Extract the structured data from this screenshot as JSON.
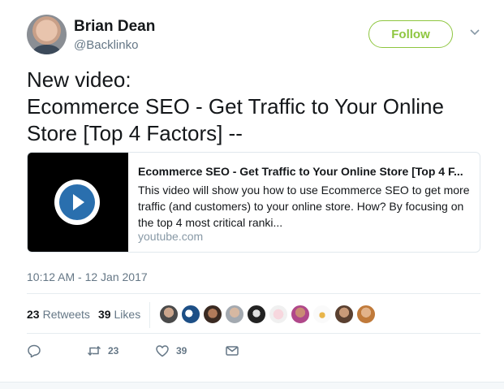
{
  "author": {
    "name": "Brian Dean",
    "handle": "@Backlinko"
  },
  "follow_label": "Follow",
  "tweet_lines": [
    "New video:",
    "Ecommerce SEO - Get Traffic to Your Online",
    "Store [Top 4 Factors] --"
  ],
  "card": {
    "title": "Ecommerce SEO - Get Traffic to Your Online Store [Top 4 F...",
    "description_lines": [
      "This video will show you how to use Ecommerce SEO to get more",
      "traffic (and customers) to your online store. How? By focusing on",
      "the top 4 most critical ranki..."
    ],
    "domain": "youtube.com"
  },
  "timestamp": "10:12 AM - 12 Jan 2017",
  "stats": {
    "retweets_count": "23",
    "retweets_label": "Retweets",
    "likes_count": "39",
    "likes_label": "Likes"
  },
  "actions": {
    "reply_count": "",
    "retweet_count": "23",
    "like_count": "39"
  },
  "colors": {
    "follow_accent": "#8ec63f",
    "play_button": "#2a6fae",
    "muted_text": "#657786"
  },
  "icons": [
    "avatar",
    "chevron-down-icon",
    "play-icon",
    "reply-icon",
    "retweet-icon",
    "like-icon",
    "message-icon"
  ]
}
